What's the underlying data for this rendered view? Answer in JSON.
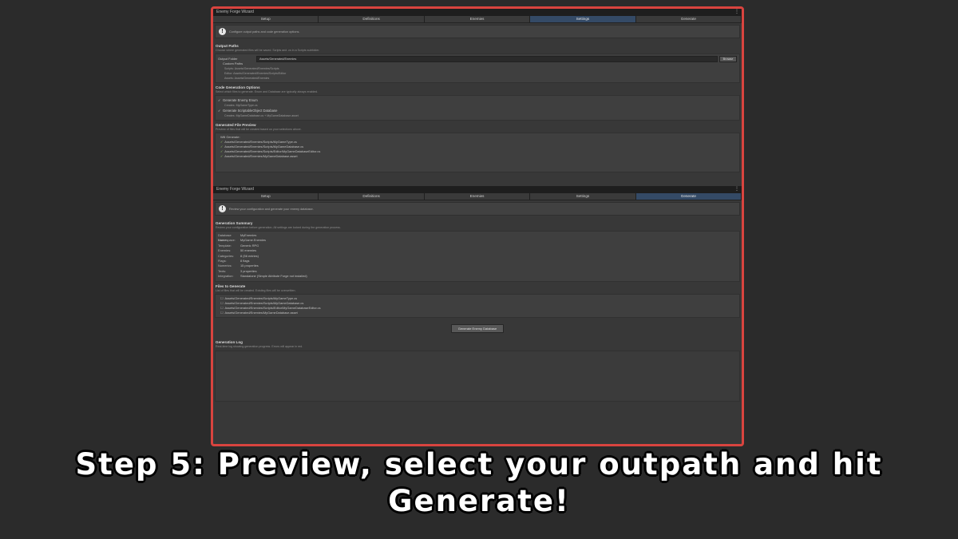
{
  "window_title": "Enemy Forge Wizard",
  "tabs": [
    "Setup",
    "Definitions",
    "Enemies",
    "Settings",
    "Generate"
  ],
  "settings_panel": {
    "info": "Configure output paths and code generation options.",
    "output_paths": {
      "title": "Output Paths",
      "desc": "Choose where generated files will be saved. Scripts and .cs in a Scripts subfolder.",
      "folder_label": "Output Folder",
      "folder_value": "Assets/Generated/Enemies",
      "browse_label": "Browse",
      "custom_label": "Custom Paths",
      "scripts": "Scripts:  Assets/Generated/Enemies/Scripts",
      "editor": "Editor:  Assets/Generated/Enemies/Scripts/Editor",
      "assets": "Assets:  Assets/Generated/Enemies"
    },
    "codegen": {
      "title": "Code Generation Options",
      "desc": "Select which files to generate. Enum and Database are typically always enabled.",
      "opt1": "Generate Enemy Enum",
      "opt1_sub": "Creates: MyGameType.cs",
      "opt2": "Generate ScriptableObject Database",
      "opt2_sub": "Creates: MyGameDatabase.cs + MyGameDatabase.asset"
    },
    "preview": {
      "title": "Generated File Preview",
      "desc": "Preview of files that will be created based on your selections above.",
      "will_generate": "Will Generate:",
      "files": [
        "Assets/Generated/Enemies/Scripts/MyGameType.cs",
        "Assets/Generated/Enemies/Scripts/MyGameDatabase.cs",
        "Assets/Generated/Enemies/Scripts/Editor/MyGameDatabaseEditor.cs",
        "Assets/Generated/Enemies/MyGameDatabase.asset"
      ]
    }
  },
  "generate_panel": {
    "info": "Review your configuration and generate your enemy database.",
    "summary": {
      "title": "Generation Summary",
      "desc": "Review your configuration before generation. All settings are locked during the generation process.",
      "rows": [
        {
          "k": "Database Name:",
          "v": "MyEnemies"
        },
        {
          "k": "Namespace:",
          "v": "MyGame.Enemies"
        },
        {
          "k": "Template:",
          "v": "Generic RPG"
        },
        {
          "k": "Enemies:",
          "v": "50 enemies"
        },
        {
          "k": "Categories:",
          "v": "8 (56 entries)"
        },
        {
          "k": "Flags:",
          "v": "8 flags"
        },
        {
          "k": "Numerics:",
          "v": "15 properties"
        },
        {
          "k": "Texts:",
          "v": "3 properties"
        },
        {
          "k": "Integration:",
          "v": "Standalone (Simple Attribute Forge not installed)"
        }
      ]
    },
    "files": {
      "title": "Files to Generate",
      "desc": "List of files that will be created. Existing files will be overwritten.",
      "items": [
        "Assets/Generated/Enemies/Scripts/MyGameType.cs",
        "Assets/Generated/Enemies/Scripts/MyGameDatabase.cs",
        "Assets/Generated/Enemies/Scripts/Editor/MyGameDatabaseEditor.cs",
        "Assets/Generated/Enemies/MyGameDatabase.asset"
      ]
    },
    "button": "Generate Enemy Database",
    "log": {
      "title": "Generation Log",
      "desc": "Real-time log showing generation progress. Errors will appear in red."
    }
  },
  "caption": {
    "line1": "Step 5: Preview, select your outpath and hit",
    "line2": "Generate!"
  },
  "colors": {
    "accent_border": "#d9443f",
    "active_tab": "#344a66"
  }
}
